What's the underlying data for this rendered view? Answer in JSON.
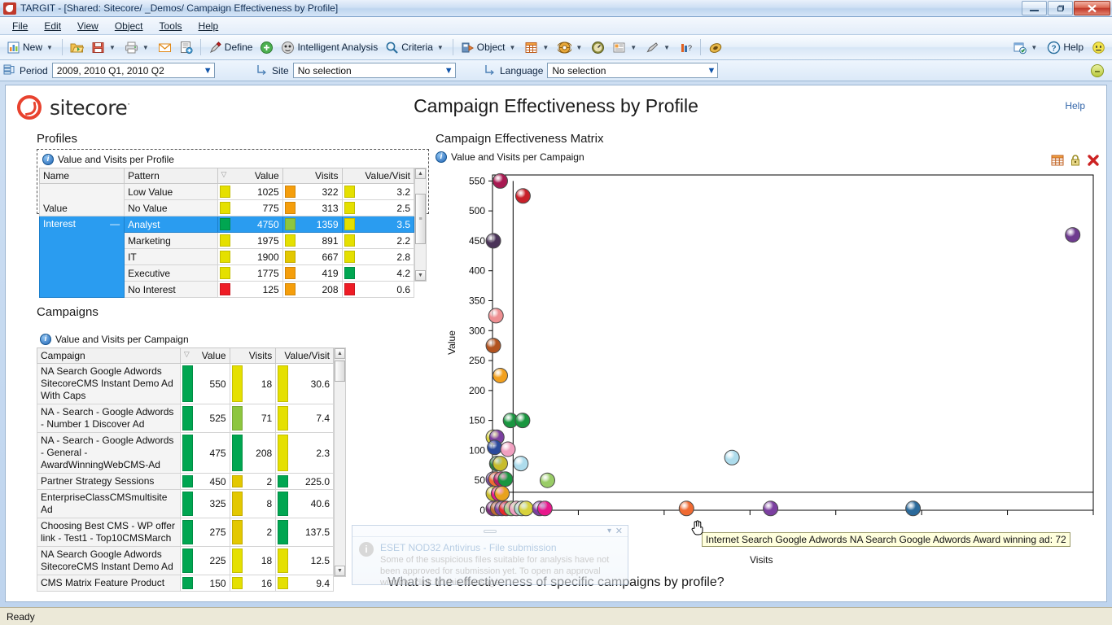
{
  "window": {
    "title": "TARGIT - [Shared: Sitecore/ _Demos/ Campaign Effectiveness by Profile]",
    "minimize": "–",
    "maximize": "❐",
    "close": "✕"
  },
  "menu": {
    "items": [
      {
        "label": "File"
      },
      {
        "label": "Edit"
      },
      {
        "label": "View"
      },
      {
        "label": "Object"
      },
      {
        "label": "Tools"
      },
      {
        "label": "Help"
      }
    ]
  },
  "toolbar": {
    "new_label": "New",
    "define_label": "Define",
    "intelligent_analysis_label": "Intelligent Analysis",
    "criteria_label": "Criteria",
    "object_label": "Object",
    "help_label": "Help",
    "icons": [
      "new-document-icon",
      "open-folder-icon",
      "save-icon",
      "print-icon",
      "email-icon",
      "export-icon",
      "define-pen-icon",
      "refresh-icon",
      "intelligent-analysis-icon",
      "criteria-search-icon",
      "object-icon",
      "table-icon",
      "globe-icon",
      "gauge-icon",
      "report-icon",
      "pen-icon",
      "bars-icon",
      "agent-icon",
      "scheduler-icon",
      "help-icon",
      "smiley-icon"
    ]
  },
  "selection_bar": {
    "period": {
      "label": "Period",
      "value": "2009, 2010 Q1, 2010 Q2"
    },
    "site": {
      "label": "Site",
      "value": "No selection"
    },
    "language": {
      "label": "Language",
      "value": "No selection"
    },
    "collapse_label": "–"
  },
  "dashboard": {
    "brand": "sitecore",
    "brand_sup": "·",
    "title": "Campaign Effectiveness by Profile",
    "help_link": "Help",
    "question": "What is the effectiveness of specific campaigns by profile?"
  },
  "profiles_section": {
    "heading": "Profiles",
    "panel_title": "Value and Visits per Profile",
    "columns": [
      "Name",
      "Pattern",
      "Value",
      "Visits",
      "Value/Visit"
    ],
    "rows": [
      {
        "name": "",
        "pattern": "Low Value",
        "value": "1025",
        "visits": "322",
        "vpv": "3.2",
        "value_color": "#e5e000",
        "visits_color": "#f59e0b",
        "vpv_color": "#e5e000",
        "selected": false
      },
      {
        "name": "Value",
        "pattern": "No Value",
        "value": "775",
        "visits": "313",
        "vpv": "2.5",
        "value_color": "#e5e000",
        "visits_color": "#f59e0b",
        "vpv_color": "#e5e000",
        "selected": false
      },
      {
        "name": "Interest",
        "pattern": "Analyst",
        "value": "4750",
        "visits": "1359",
        "vpv": "3.5",
        "value_color": "#00a651",
        "visits_color": "#8dc63f",
        "vpv_color": "#e5e000",
        "selected": true
      },
      {
        "name": "",
        "pattern": "Marketing",
        "value": "1975",
        "visits": "891",
        "vpv": "2.2",
        "value_color": "#e5e000",
        "visits_color": "#e5e000",
        "vpv_color": "#e5e000",
        "selected": false
      },
      {
        "name": "",
        "pattern": "IT",
        "value": "1900",
        "visits": "667",
        "vpv": "2.8",
        "value_color": "#e5e000",
        "visits_color": "#e3c800",
        "vpv_color": "#e5e000",
        "selected": false
      },
      {
        "name": "",
        "pattern": "Executive",
        "value": "1775",
        "visits": "419",
        "vpv": "4.2",
        "value_color": "#e5e000",
        "visits_color": "#f59e0b",
        "vpv_color": "#00a651",
        "selected": false
      },
      {
        "name": "",
        "pattern": "No Interest",
        "value": "125",
        "visits": "208",
        "vpv": "0.6",
        "value_color": "#ee1c25",
        "visits_color": "#f59e0b",
        "vpv_color": "#ee1c25",
        "selected": false
      }
    ],
    "collapse_marker": "—"
  },
  "campaigns_section": {
    "heading": "Campaigns",
    "panel_title": "Value and Visits per Campaign",
    "columns": [
      "Campaign",
      "Value",
      "Visits",
      "Value/Visit"
    ],
    "rows": [
      {
        "campaign": "NA Search Google Adwords SitecoreCMS Instant Demo Ad With Caps",
        "value": "550",
        "visits": "18",
        "vpv": "30.6",
        "value_color": "#00a651",
        "visits_color": "#e5e000",
        "vpv_color": "#e5e000"
      },
      {
        "campaign": "NA - Search - Google Adwords - Number 1 Discover Ad",
        "value": "525",
        "visits": "71",
        "vpv": "7.4",
        "value_color": "#00a651",
        "visits_color": "#8dc63f",
        "vpv_color": "#e5e000"
      },
      {
        "campaign": "NA - Search - Google Adwords - General - AwardWinningWebCMS-Ad",
        "value": "475",
        "visits": "208",
        "vpv": "2.3",
        "value_color": "#00a651",
        "visits_color": "#00a651",
        "vpv_color": "#e5e000"
      },
      {
        "campaign": "Partner Strategy Sessions",
        "value": "450",
        "visits": "2",
        "vpv": "225.0",
        "value_color": "#00a651",
        "visits_color": "#e3c800",
        "vpv_color": "#00a651"
      },
      {
        "campaign": "EnterpriseClassCMSmultisite Ad",
        "value": "325",
        "visits": "8",
        "vpv": "40.6",
        "value_color": "#00a651",
        "visits_color": "#e3c800",
        "vpv_color": "#00a651"
      },
      {
        "campaign": "Choosing Best CMS - WP offer link - Test1 - Top10CMSMarch",
        "value": "275",
        "visits": "2",
        "vpv": "137.5",
        "value_color": "#00a651",
        "visits_color": "#e3c800",
        "vpv_color": "#00a651"
      },
      {
        "campaign": "NA Search Google Adwords SitecoreCMS Instant Demo Ad",
        "value": "225",
        "visits": "18",
        "vpv": "12.5",
        "value_color": "#00a651",
        "visits_color": "#e5e000",
        "vpv_color": "#e5e000"
      },
      {
        "campaign": "CMS Matrix Feature Product",
        "value": "150",
        "visits": "16",
        "vpv": "9.4",
        "value_color": "#00a651",
        "visits_color": "#e5e000",
        "vpv_color": "#e5e000"
      }
    ]
  },
  "matrix_section": {
    "heading": "Campaign Effectiveness Matrix",
    "panel_title": "Value and Visits per Campaign",
    "icons": [
      "table-view-icon",
      "lock-icon",
      "close-icon"
    ]
  },
  "tooltip": {
    "text": "Internet Search Google Adwords NA Search Google Adwords Award winning ad: 72"
  },
  "notification": {
    "title": "ESET NOD32 Antivirus - File submission",
    "body": "Some of the suspicious files suitable for analysis have not been approved for submission yet. To open an approval window, click on this message.",
    "minimize": "▾",
    "close": "✕"
  },
  "statusbar": {
    "text": "Ready"
  },
  "chart_data": {
    "type": "scatter",
    "title": "Value and Visits per Campaign",
    "xlabel": "Visits",
    "ylabel": "Value",
    "xlim": [
      0,
      1400
    ],
    "ylim": [
      0,
      560
    ],
    "yticks": [
      0,
      50,
      100,
      150,
      200,
      250,
      300,
      350,
      400,
      450,
      500,
      550
    ],
    "xticks": [
      0,
      200,
      400,
      600,
      800,
      1000,
      1200,
      1400
    ],
    "grid": false,
    "legend": "none",
    "reference_lines": {
      "vertical_x": 48,
      "horizontal_y": 30
    },
    "points": [
      {
        "x": 18,
        "y": 550,
        "color": "#a81a52",
        "r": 9
      },
      {
        "x": 71,
        "y": 525,
        "color": "#c8202a",
        "r": 9
      },
      {
        "x": 1352,
        "y": 460,
        "color": "#6e3b8f",
        "r": 9
      },
      {
        "x": 2,
        "y": 450,
        "color": "#4a3358",
        "r": 9
      },
      {
        "x": 8,
        "y": 325,
        "color": "#ee8f92",
        "r": 9
      },
      {
        "x": 2,
        "y": 275,
        "color": "#b2531f",
        "r": 9
      },
      {
        "x": 18,
        "y": 225,
        "color": "#f2a01e",
        "r": 9
      },
      {
        "x": 42,
        "y": 150,
        "color": "#1a9640",
        "r": 9
      },
      {
        "x": 70,
        "y": 150,
        "color": "#1a9640",
        "r": 9
      },
      {
        "x": 2,
        "y": 122,
        "color": "#d8d23c",
        "r": 9
      },
      {
        "x": 10,
        "y": 122,
        "color": "#7b3fa0",
        "r": 9
      },
      {
        "x": 5,
        "y": 105,
        "color": "#2b4a9b",
        "r": 9
      },
      {
        "x": 36,
        "y": 102,
        "color": "#f0a0c0",
        "r": 9
      },
      {
        "x": 558,
        "y": 88,
        "color": "#aedcec",
        "r": 9
      },
      {
        "x": 10,
        "y": 78,
        "color": "#2f7f3b",
        "r": 9
      },
      {
        "x": 18,
        "y": 78,
        "color": "#c8bc2c",
        "r": 9
      },
      {
        "x": 66,
        "y": 78,
        "color": "#aedcec",
        "r": 9
      },
      {
        "x": 2,
        "y": 52,
        "color": "#7b4fa0",
        "r": 9
      },
      {
        "x": 8,
        "y": 52,
        "color": "#f06a32",
        "r": 9
      },
      {
        "x": 20,
        "y": 52,
        "color": "#b51a6a",
        "r": 9
      },
      {
        "x": 30,
        "y": 52,
        "color": "#1a9640",
        "r": 9
      },
      {
        "x": 128,
        "y": 50,
        "color": "#99cc66",
        "r": 9
      },
      {
        "x": 2,
        "y": 28,
        "color": "#c8bc2c",
        "r": 9
      },
      {
        "x": 14,
        "y": 28,
        "color": "#e8188c",
        "r": 9
      },
      {
        "x": 22,
        "y": 28,
        "color": "#e8a21e",
        "r": 9
      },
      {
        "x": 2,
        "y": 3,
        "color": "#7b2f7b",
        "r": 9
      },
      {
        "x": 12,
        "y": 3,
        "color": "#c06a32",
        "r": 9
      },
      {
        "x": 22,
        "y": 3,
        "color": "#7b3fa0",
        "r": 9
      },
      {
        "x": 32,
        "y": 3,
        "color": "#e82a2a",
        "r": 9
      },
      {
        "x": 44,
        "y": 3,
        "color": "#9acc7c",
        "r": 9
      },
      {
        "x": 56,
        "y": 3,
        "color": "#f0a0c0",
        "r": 9
      },
      {
        "x": 68,
        "y": 3,
        "color": "#a8d8c8",
        "r": 9
      },
      {
        "x": 78,
        "y": 3,
        "color": "#d8d23c",
        "r": 9
      },
      {
        "x": 110,
        "y": 3,
        "color": "#7b3fa0",
        "r": 9
      },
      {
        "x": 122,
        "y": 3,
        "color": "#e8188c",
        "r": 9
      },
      {
        "x": 452,
        "y": 3,
        "color": "#f06a32",
        "r": 9
      },
      {
        "x": 648,
        "y": 3,
        "color": "#7b3fa0",
        "r": 9
      },
      {
        "x": 980,
        "y": 3,
        "color": "#2b6a9b",
        "r": 9
      }
    ]
  }
}
